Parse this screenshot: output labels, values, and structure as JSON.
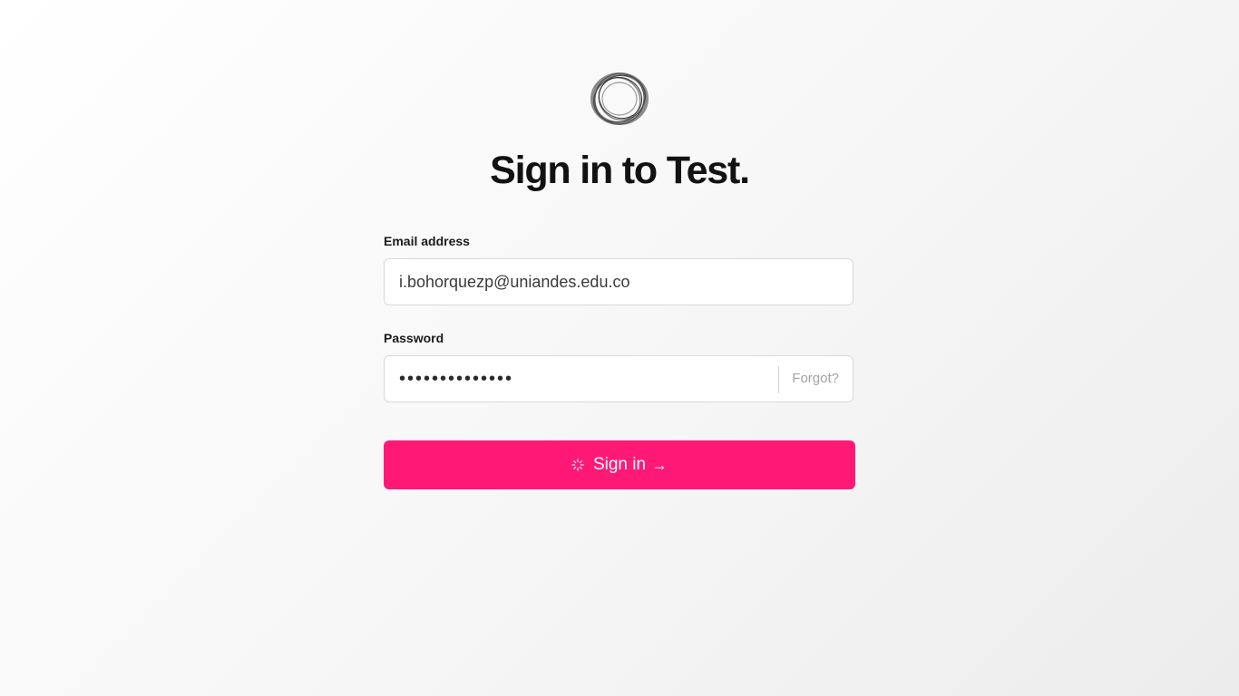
{
  "header": {
    "logo_icon": "swirl-ring-logo-icon",
    "title": "Sign in to Test."
  },
  "form": {
    "email_label": "Email address",
    "email_value": "i.bohorquezp@uniandes.edu.co",
    "password_label": "Password",
    "password_value": "••••••••••••••",
    "forgot_label": "Forgot?",
    "submit_label": "Sign in",
    "submit_arrow": "→",
    "submit_loading_icon": "spinner-icon"
  },
  "colors": {
    "accent": "#ff1976",
    "title_text": "#121212",
    "muted_text": "#a3a3a3"
  }
}
